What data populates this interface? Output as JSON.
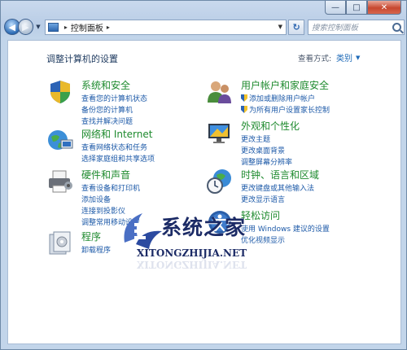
{
  "window": {
    "caption": {
      "minimize": "—",
      "maximize": "□",
      "close": "✕"
    }
  },
  "nav": {
    "back_glyph": "◀",
    "forward_glyph": "▶",
    "history_dropdown_glyph": "▼",
    "address": {
      "path": [
        "控制面板"
      ],
      "separator": "▸",
      "dropdown_glyph": "▼"
    },
    "refresh_glyph": "↻",
    "search_placeholder": "搜索控制面板"
  },
  "page": {
    "title": "调整计算机的设置",
    "view_by_label": "查看方式:",
    "view_by_value": "类别",
    "view_by_glyph": "▼"
  },
  "categories": [
    {
      "id": "system-security",
      "icon": "shield-icon",
      "title": "系统和安全",
      "links": [
        "查看您的计算机状态",
        "备份您的计算机",
        "查找并解决问题"
      ]
    },
    {
      "id": "network",
      "icon": "globe-network-icon",
      "title": "网络和 Internet",
      "links": [
        "查看网络状态和任务",
        "选择家庭组和共享选项"
      ]
    },
    {
      "id": "hardware-sound",
      "icon": "printer-icon",
      "title": "硬件和声音",
      "links": [
        "查看设备和打印机",
        "添加设备",
        "连接到投影仪",
        "调整常用移动设置"
      ]
    },
    {
      "id": "programs",
      "icon": "programs-icon",
      "title": "程序",
      "links": [
        "卸载程序"
      ]
    },
    {
      "id": "user-accounts",
      "icon": "users-icon",
      "title": "用户帐户和家庭安全",
      "links": [
        "添加或删除用户帐户",
        "为所有用户设置家长控制"
      ]
    },
    {
      "id": "appearance",
      "icon": "display-icon",
      "title": "外观和个性化",
      "links": [
        "更改主题",
        "更改桌面背景",
        "调整屏幕分辨率"
      ]
    },
    {
      "id": "clock-region",
      "icon": "clock-globe-icon",
      "title": "时钟、语言和区域",
      "links": [
        "更改键盘或其他输入法",
        "更改显示语言"
      ]
    },
    {
      "id": "ease-of-access",
      "icon": "ease-of-access-icon",
      "title": "轻松访问",
      "links": [
        "使用 Windows 建议的设置",
        "优化视频显示"
      ]
    }
  ],
  "watermark": {
    "title": "系统之家",
    "url": "XITONGZHIJIA.NET"
  },
  "colors": {
    "category_title": "#1e8a2e",
    "link": "#1d5aa8",
    "watermark": "#1c2b66"
  }
}
